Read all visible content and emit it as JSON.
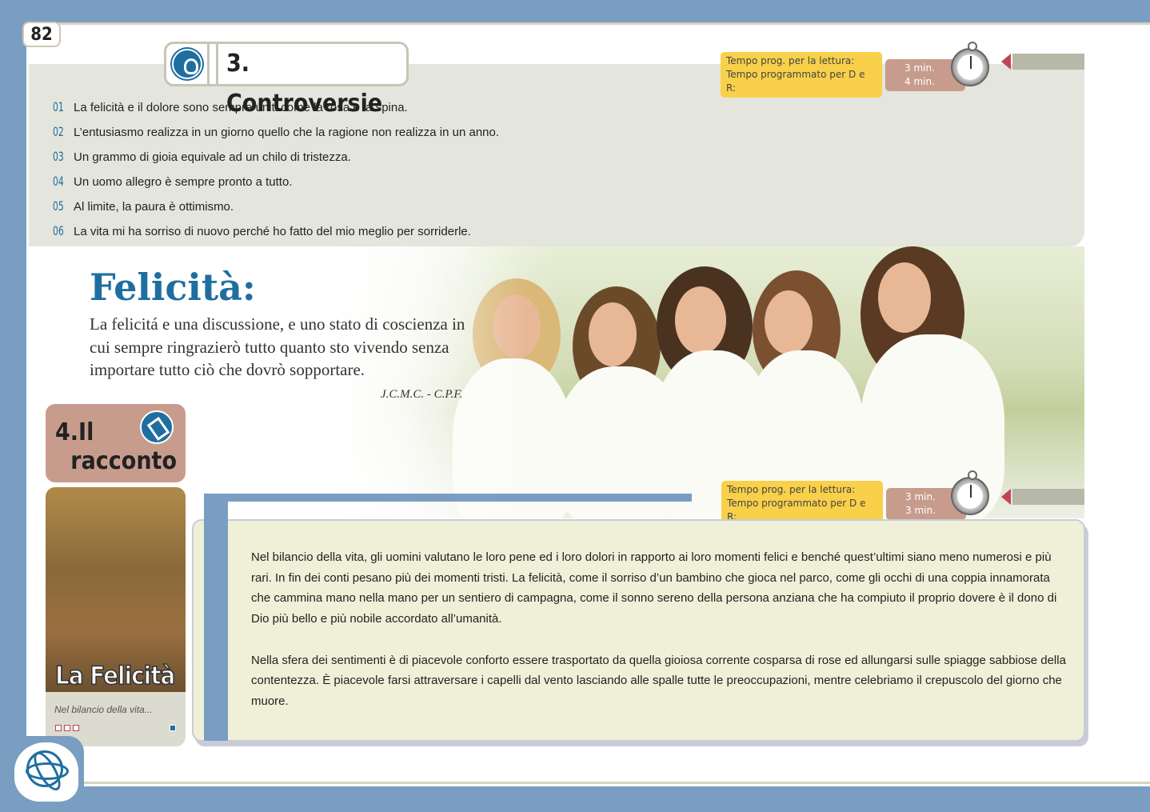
{
  "page_number": "82",
  "section3": {
    "title": "3. Controversie",
    "timer": {
      "label_reading": "Tempo prog. per la lettura:",
      "label_dr": "Tempo programmato per D e R:",
      "value_reading": "3 min.",
      "value_dr": "4 min."
    },
    "quotes": [
      {
        "num": "01",
        "text": "La felicità e il dolore sono sempre uniti come la rosa e la spina."
      },
      {
        "num": "02",
        "text": "L’entusiasmo realizza in un giorno quello che la ragione non realizza in un anno."
      },
      {
        "num": "03",
        "text": "Un grammo di gioia equivale ad un chilo di tristezza."
      },
      {
        "num": "04",
        "text": "Un uomo allegro è sempre pronto a tutto."
      },
      {
        "num": "05",
        "text": "Al limite, la paura è ottimismo."
      },
      {
        "num": "06",
        "text": "La vita mi ha sorriso di nuovo perché ho fatto del mio meglio per sorriderle."
      }
    ]
  },
  "felicita": {
    "title": "Felicità:",
    "text": "La felicitá e una discussione, e uno stato di coscienza in cui sempre ringrazierò tutto quanto sto vivendo senza importare tutto ciò  che dovrò sopportare.",
    "author": "J.C.M.C. - C.P.F."
  },
  "section4": {
    "title_line1": "4.Il",
    "title_line2": "racconto",
    "timer": {
      "label_reading": "Tempo prog. per la lettura:",
      "label_dr": "Tempo programmato per D e R:",
      "value_reading": "3 min.",
      "value_dr": "3 min."
    },
    "book_title": "La Felicità",
    "book_subtitle": "Nel bilancio della vita...",
    "paragraphs": [
      "Nel bilancio della vita, gli uomini valutano le loro pene ed i loro dolori in rapporto ai loro momenti felici e benché quest’ultimi siano meno numerosi e più rari. In fin dei conti pesano più dei momenti tristi. La felicità, come il sorriso d’un bambino che gioca nel parco, come gli occhi di una coppia innamorata che cammina  mano nella mano per un sentiero di campagna, come il sonno sereno della persona anziana che ha compiuto il proprio dovere è il dono di Dio più bello e più nobile accordato all’umanità.",
      "Nella sfera dei sentimenti è di piacevole conforto essere trasportato da quella gioiosa corrente cosparsa di rose ed allungarsi sulle spiagge sabbiose della contentezza. È piacevole farsi attraversare i capelli dal vento lasciando alle spalle tutte le preoccupazioni, mentre celebriamo il crepuscolo del giorno che muore."
    ]
  },
  "colors": {
    "accent_blue": "#1f6ea0",
    "frame_blue": "#7a9ec2",
    "timer_yellow": "#f8d04a",
    "timer_rose": "#c89c8c",
    "panel_gray": "#e4e5dc",
    "reading_cream": "#f0f0d8"
  },
  "icons": [
    "i-am-head-icon",
    "stopwatch-icon",
    "pencil-icon",
    "brain-atom-logo-icon"
  ]
}
